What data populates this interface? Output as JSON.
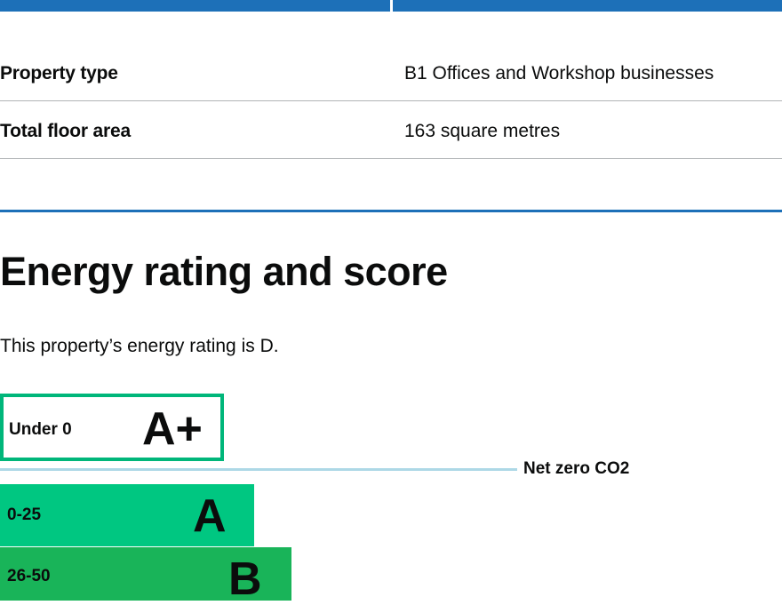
{
  "details": [
    {
      "label": "Property type",
      "value": "B1 Offices and Workshop businesses"
    },
    {
      "label": "Total floor area",
      "value": "163 square metres"
    }
  ],
  "section": {
    "heading": "Energy rating and score",
    "rating_text": "This property’s energy rating is D."
  },
  "chart": {
    "bands": [
      {
        "range": "Under 0",
        "letter": "A+",
        "color": "#00b67a"
      },
      {
        "range": "0-25",
        "letter": "A",
        "color": "#00c781"
      },
      {
        "range": "26-50",
        "letter": "B",
        "color": "#19b459"
      }
    ],
    "net_zero_label": "Net zero CO2",
    "net_zero_color": "#add8e6"
  },
  "colors": {
    "accent": "#1d70b8",
    "divider": "#b1b4b6"
  }
}
